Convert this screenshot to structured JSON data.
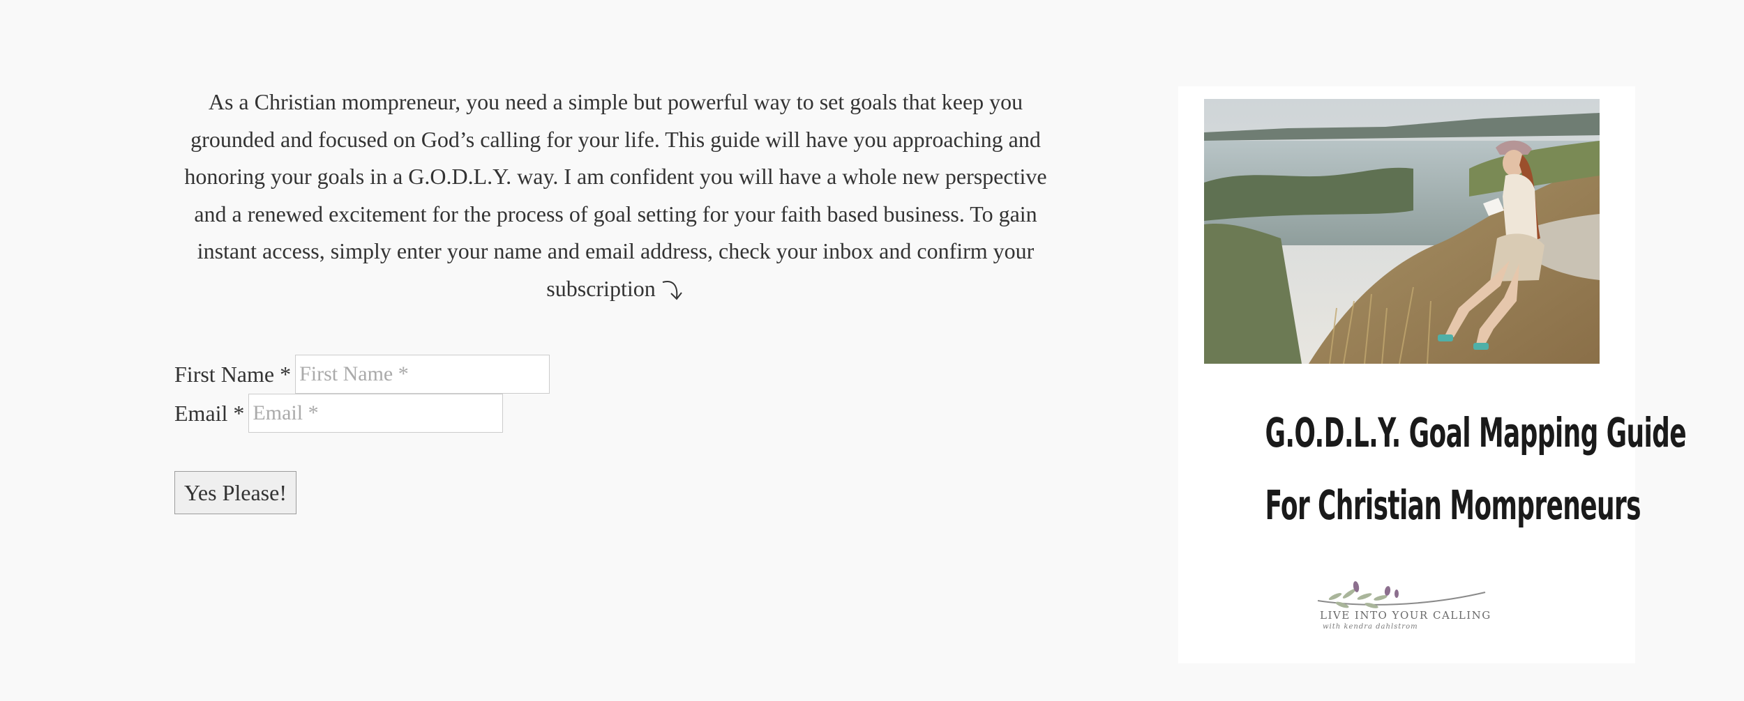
{
  "intro": {
    "text": "As a Christian mompreneur, you need a simple but powerful way to set goals that keep you grounded and focused on God’s calling for your life. This guide will have you approaching and honoring your goals in a G.O.D.L.Y. way. I am confident you will have a whole new perspective and a renewed excitement for the process of goal setting for your faith based business. To gain instant access, simply enter your name and email address, check your inbox and confirm your subscription",
    "arrow_icon": "curved-arrow-down-right-icon"
  },
  "form": {
    "first_name_label": "First Name *",
    "first_name_placeholder": "First Name *",
    "first_name_value": "",
    "email_label": "Email *",
    "email_placeholder": "Email *",
    "email_value": "",
    "submit_label": "Yes Please!"
  },
  "cover": {
    "photo_icon": "woman-writing-on-hillside-photo",
    "title_line1": "G.O.D.L.Y. Goal Mapping Guide",
    "title_line2": "For Christian Mompreneurs",
    "logo_text": "LIVE INTO YOUR CALLING",
    "logo_subtext": "with kendra dahlstrom"
  },
  "colors": {
    "background": "#f9f9f9",
    "text": "#333333",
    "button_bg": "#efefef"
  }
}
